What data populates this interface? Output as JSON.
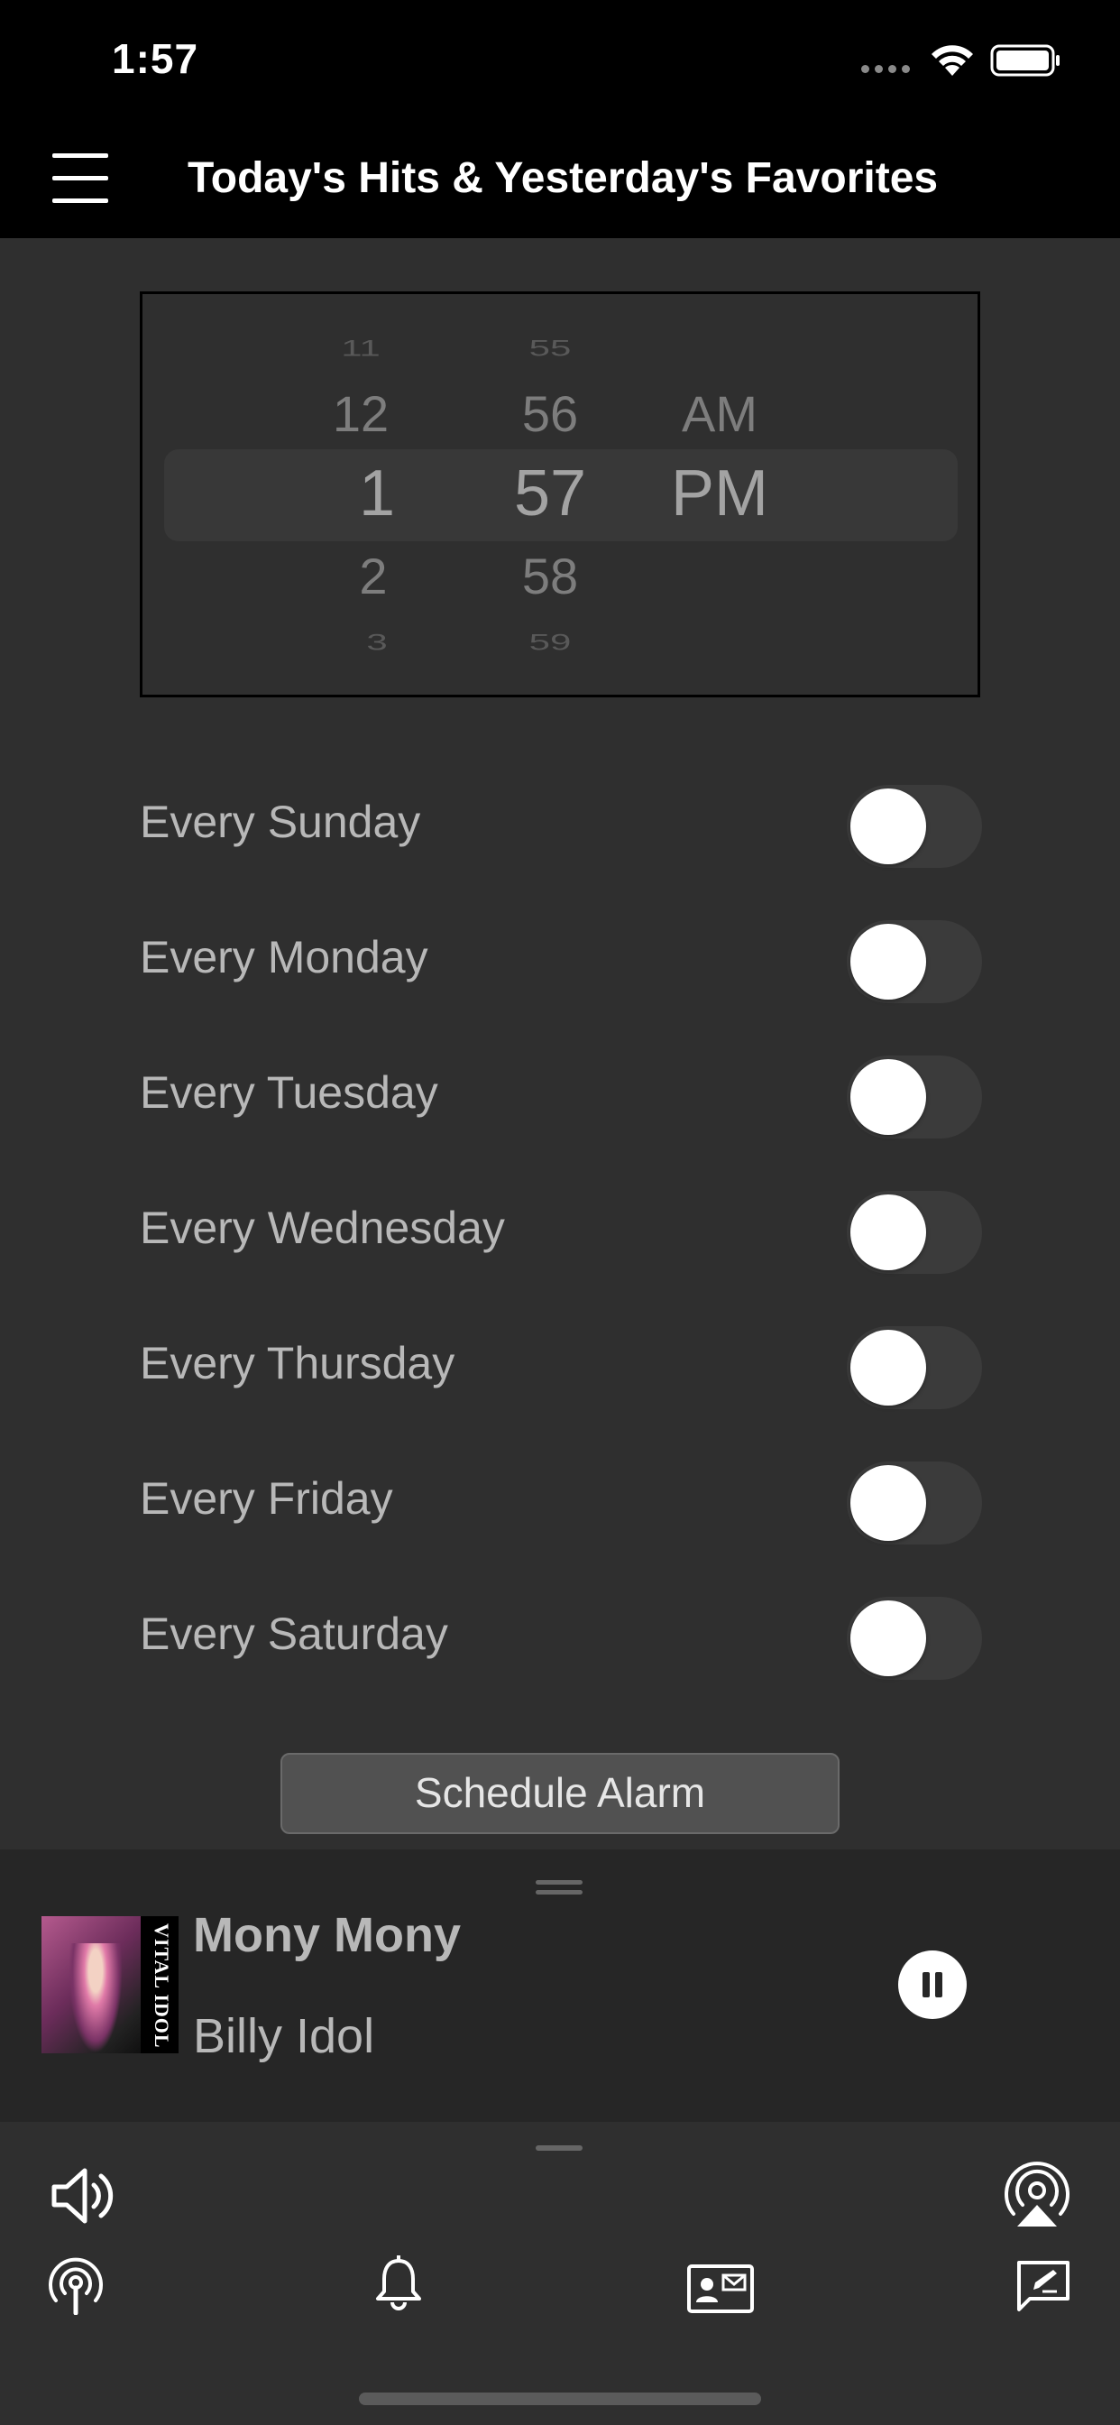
{
  "status_bar": {
    "time": "1:57"
  },
  "header": {
    "title": "Today's Hits & Yesterday's Favorites"
  },
  "time_picker": {
    "hours": [
      "11",
      "12",
      "1",
      "2",
      "3"
    ],
    "minutes": [
      "55",
      "56",
      "57",
      "58",
      "59"
    ],
    "periods": [
      "AM",
      "PM"
    ],
    "selected": {
      "hour": "1",
      "minute": "57",
      "period": "PM"
    }
  },
  "days": [
    {
      "label": "Every Sunday",
      "enabled": false
    },
    {
      "label": "Every Monday",
      "enabled": false
    },
    {
      "label": "Every Tuesday",
      "enabled": false
    },
    {
      "label": "Every Wednesday",
      "enabled": false
    },
    {
      "label": "Every Thursday",
      "enabled": false
    },
    {
      "label": "Every Friday",
      "enabled": false
    },
    {
      "label": "Every Saturday",
      "enabled": false
    }
  ],
  "schedule_button": {
    "label": "Schedule Alarm"
  },
  "now_playing": {
    "title": "Mony Mony",
    "artist": "Billy Idol",
    "album_art_text": "VITAL IDOL"
  },
  "toolbar": {
    "icons": [
      "speaker-volume-icon",
      "airplay-icon",
      "broadcast-icon",
      "bell-icon",
      "contact-card-icon",
      "compose-icon"
    ]
  },
  "colors": {
    "background": "#2f2f2f",
    "header": "#000000",
    "player": "#262626",
    "text_muted": "#b8b8b8"
  }
}
